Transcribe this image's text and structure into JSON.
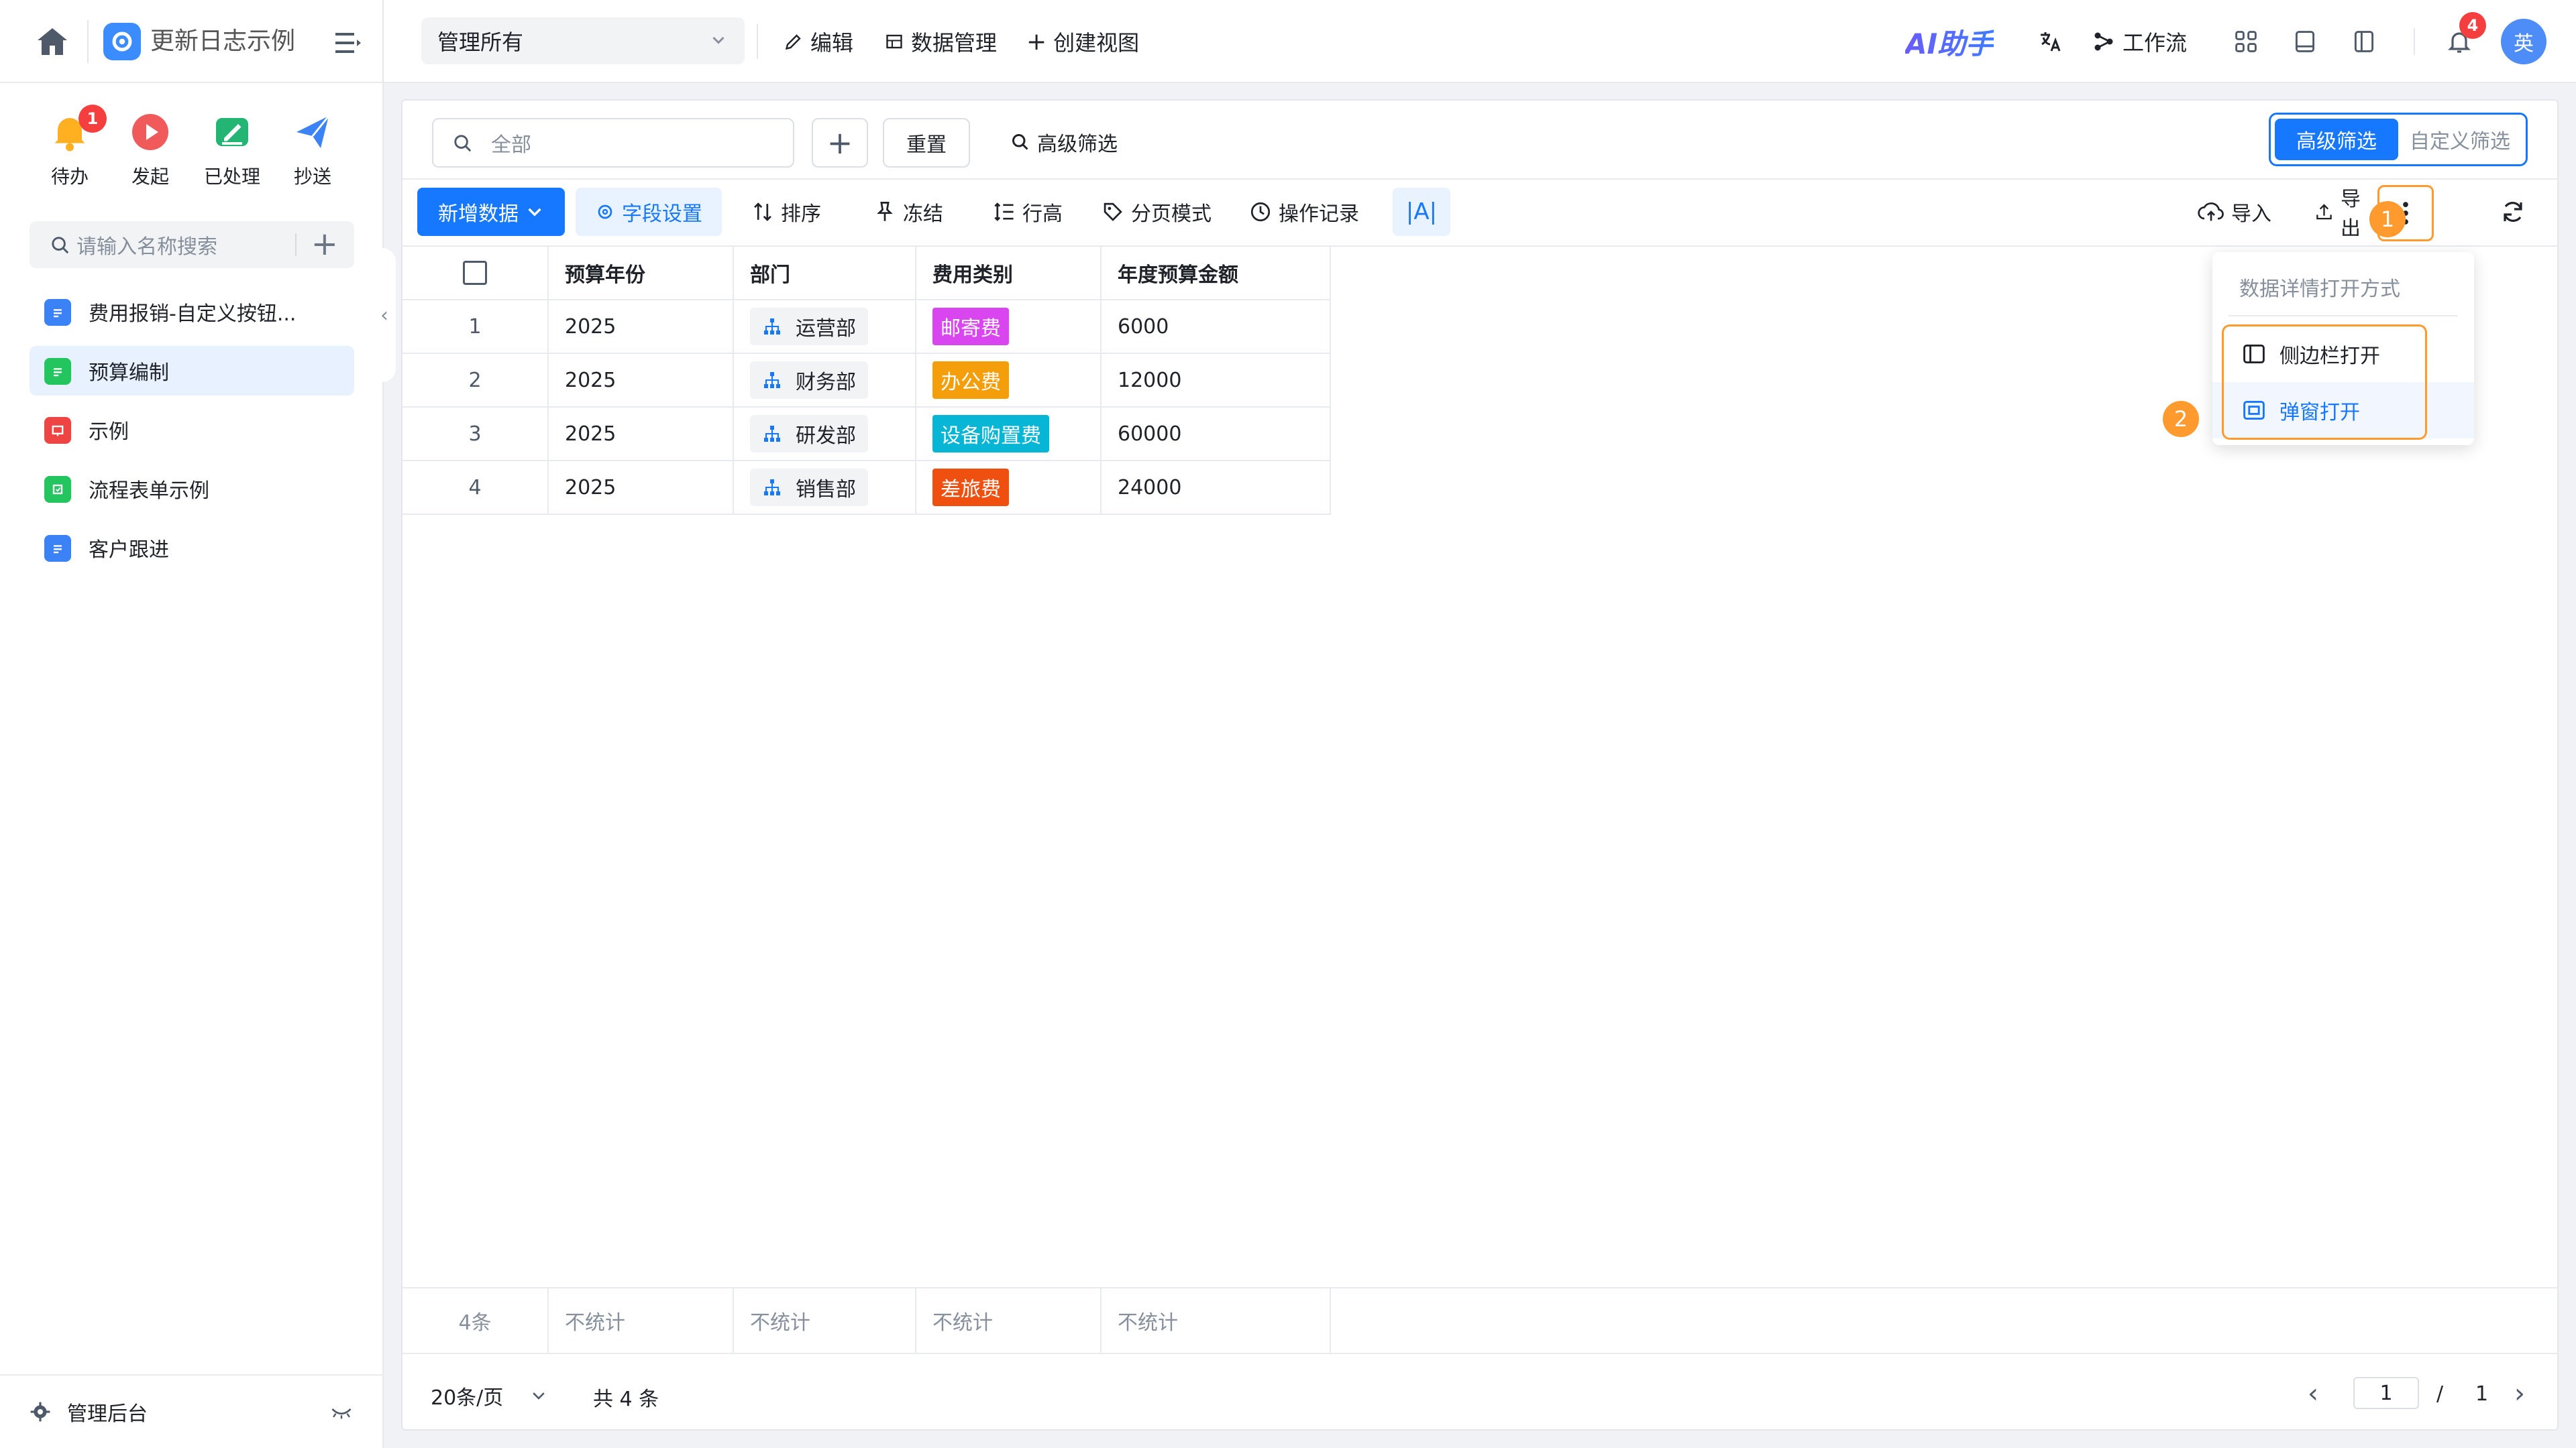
{
  "topbar": {
    "app_title": "更新日志示例",
    "view_select": "管理所有",
    "edit": "编辑",
    "data_mgmt": "数据管理",
    "create_view": "创建视图",
    "ai": "AI助手",
    "workflow": "工作流",
    "notif_count": "4",
    "avatar": "英"
  },
  "sidebar": {
    "quick": [
      {
        "label": "待办",
        "badge": "1"
      },
      {
        "label": "发起"
      },
      {
        "label": "已处理"
      },
      {
        "label": "抄送"
      }
    ],
    "search_placeholder": "请输入名称搜索",
    "items": [
      {
        "label": "费用报销-自定义按钮...",
        "color": "#3b82f6"
      },
      {
        "label": "预算编制",
        "color": "#22c55e"
      },
      {
        "label": "示例",
        "color": "#ef4444"
      },
      {
        "label": "流程表单示例",
        "color": "#22c55e"
      },
      {
        "label": "客户跟进",
        "color": "#3b82f6"
      }
    ],
    "footer": "管理后台"
  },
  "filter": {
    "search_placeholder": "全部",
    "reset": "重置",
    "advanced": "高级筛选",
    "mode_advanced": "高级筛选",
    "mode_custom": "自定义筛选"
  },
  "toolbar": {
    "new_data": "新增数据",
    "field_settings": "字段设置",
    "sort": "排序",
    "freeze": "冻结",
    "row_height": "行高",
    "page_mode": "分页模式",
    "op_log": "操作记录",
    "font": "|A|",
    "import": "导入",
    "export": "导出"
  },
  "annotations": {
    "one": "1",
    "two": "2"
  },
  "table": {
    "headers": [
      "预算年份",
      "部门",
      "费用类别",
      "年度预算金额"
    ],
    "rows": [
      {
        "no": "1",
        "year": "2025",
        "dept": "运营部",
        "category": "邮寄费",
        "cat_color": "#d946ef",
        "amount": "6000"
      },
      {
        "no": "2",
        "year": "2025",
        "dept": "财务部",
        "category": "办公费",
        "cat_color": "#f59e0b",
        "amount": "12000"
      },
      {
        "no": "3",
        "year": "2025",
        "dept": "研发部",
        "category": "设备购置费",
        "cat_color": "#06b6d4",
        "amount": "60000"
      },
      {
        "no": "4",
        "year": "2025",
        "dept": "销售部",
        "category": "差旅费",
        "cat_color": "#f0500f",
        "amount": "24000"
      }
    ],
    "footer_count": "4条",
    "footer_stats": [
      "不统计",
      "不统计",
      "不统计",
      "不统计"
    ]
  },
  "pager": {
    "page_size": "20条/页",
    "total": "共 4 条",
    "current": "1",
    "slash": "/",
    "pages": "1"
  },
  "dropdown": {
    "title": "数据详情打开方式",
    "sidebar_open": "侧边栏打开",
    "popup_open": "弹窗打开"
  }
}
